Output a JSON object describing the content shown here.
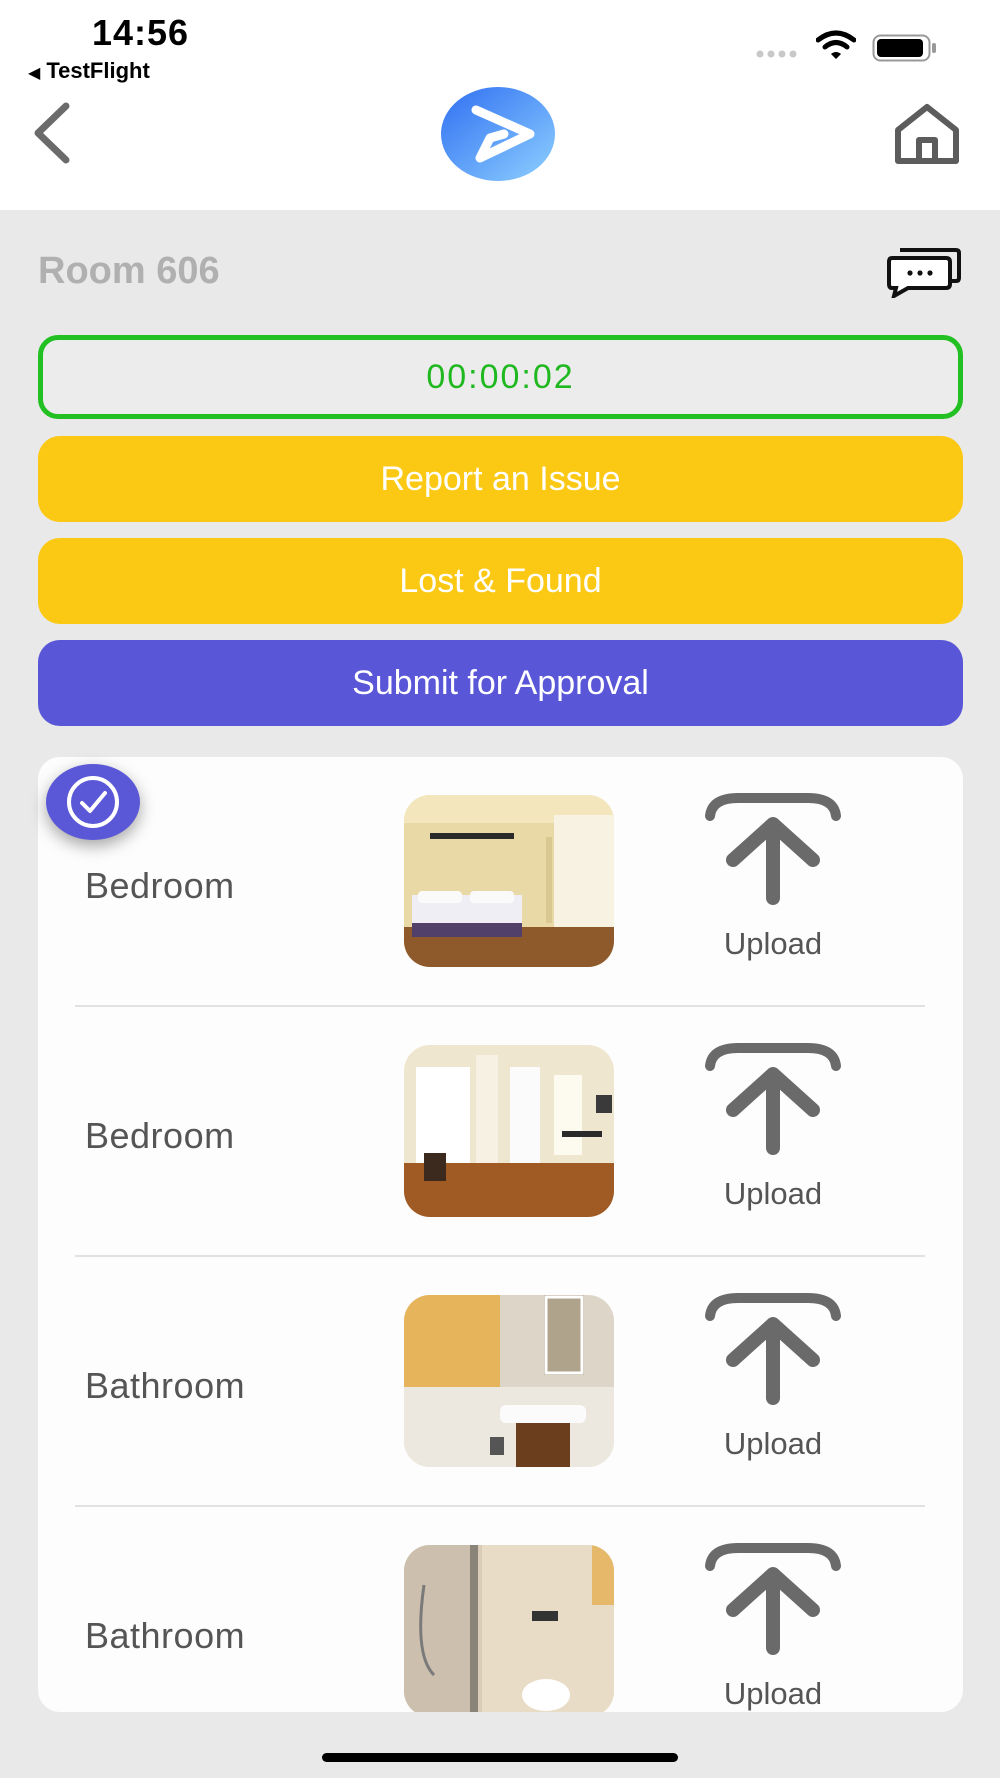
{
  "status_bar": {
    "time": "14:56",
    "back_app": "TestFlight"
  },
  "header": {
    "back_icon": "chevron-left-icon",
    "logo_icon": "play-logo-icon",
    "home_icon": "home-icon"
  },
  "room": {
    "title": "Room 606",
    "chat_icon": "chat-bubbles-icon"
  },
  "timer": "00:00:02",
  "buttons": {
    "report_issue": "Report an Issue",
    "lost_found": "Lost & Found",
    "submit": "Submit for Approval"
  },
  "areas": [
    {
      "label": "Bedroom",
      "upload": "Upload"
    },
    {
      "label": "Bedroom",
      "upload": "Upload"
    },
    {
      "label": "Bathroom",
      "upload": "Upload"
    },
    {
      "label": "Bathroom",
      "upload": "Upload"
    }
  ],
  "colors": {
    "timer_green": "#22c022",
    "yellow": "#fbc814",
    "purple": "#5957d8"
  }
}
